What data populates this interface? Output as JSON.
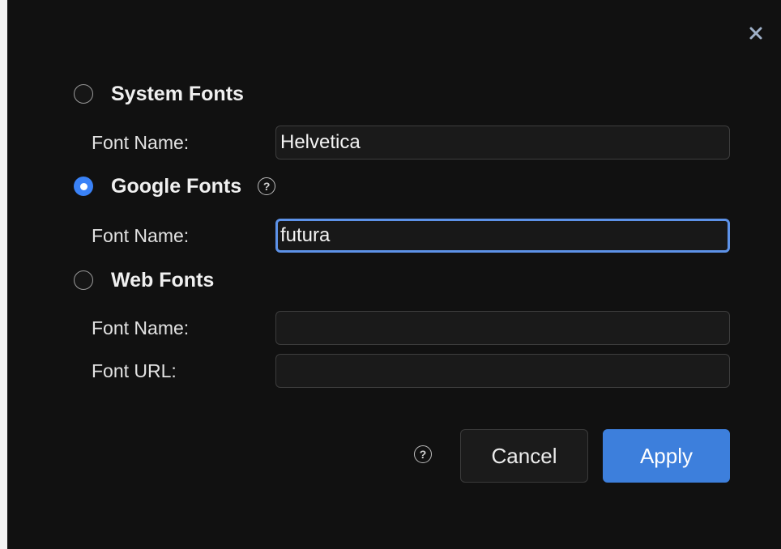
{
  "dialog": {
    "close_icon": "close-icon",
    "system_fonts": {
      "label": "System Fonts",
      "selected": false,
      "font_name_label": "Font Name:",
      "font_name_value": "Helvetica"
    },
    "google_fonts": {
      "label": "Google Fonts",
      "selected": true,
      "help_icon": "question-circle-icon",
      "font_name_label": "Font Name:",
      "font_name_value": "futura"
    },
    "web_fonts": {
      "label": "Web Fonts",
      "selected": false,
      "font_name_label": "Font Name:",
      "font_name_value": "",
      "font_url_label": "Font URL:",
      "font_url_value": ""
    },
    "footer": {
      "help_icon": "question-circle-icon",
      "cancel_label": "Cancel",
      "apply_label": "Apply"
    }
  },
  "colors": {
    "background": "#111111",
    "accent": "#3a82f7",
    "apply_button": "#3d7fdc",
    "focus_ring": "#5d92e8"
  }
}
